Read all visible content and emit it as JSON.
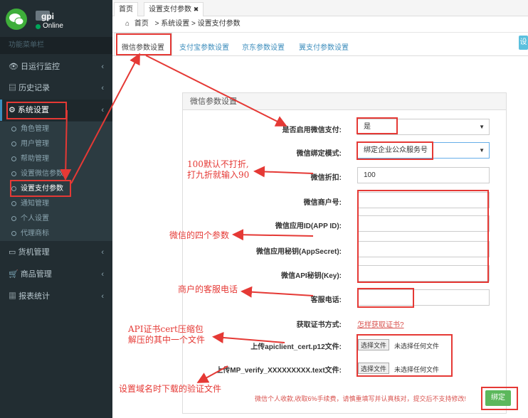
{
  "user": {
    "name": "gpi",
    "status": "Online"
  },
  "sidebar": {
    "header": "功能菜单栏",
    "items": [
      {
        "label": "日运行监控",
        "icon": "eye-icon"
      },
      {
        "label": "历史记录",
        "icon": "book-icon"
      },
      {
        "label": "系统设置",
        "icon": "gear-icon"
      },
      {
        "label": "货机管理",
        "icon": "laptop-icon"
      },
      {
        "label": "商品管理",
        "icon": "cart-icon"
      },
      {
        "label": "报表统计",
        "icon": "table-icon"
      }
    ],
    "subitems": [
      "角色管理",
      "用户管理",
      "帮助管理",
      "设置微信参数",
      "设置支付参数",
      "通知管理",
      "个人设置",
      "代理商标"
    ]
  },
  "top_tabs": {
    "home": "首页",
    "current": "设置支付参数",
    "close": "✖"
  },
  "breadcrumb": {
    "home": "首页",
    "path": "> 系统设置 > 设置支付参数"
  },
  "page_tabs": [
    "微信参数设置",
    "支付宝参数设置",
    "京东参数设置",
    "翼支付参数设置"
  ],
  "right_button": "设",
  "panel": {
    "title": "微信参数设置"
  },
  "form": {
    "enable_label": "是否启用微信支付:",
    "enable_value": "是",
    "mode_label": "微信绑定模式:",
    "mode_value": "绑定企业公众服务号",
    "discount_label": "微信折扣:",
    "discount_value": "100",
    "merchant_label": "微信商户号:",
    "appid_label": "微信应用ID(APP ID):",
    "secret_label": "微信应用秘钥(AppSecret):",
    "apikey_label": "微信API秘钥(Key):",
    "service_label": "客服电话:",
    "cert_label": "获取证书方式:",
    "cert_link": "怎样获取证书?",
    "p12_label": "上传apiclient_cert.p12文件:",
    "verify_label": "上传MP_verify_XXXXXXXXX.text文件:",
    "file_button": "选择文件",
    "no_file": "未选择任何文件",
    "warning": "微信个人收款,收取6%手续费，请慎重填写并认真核对，提交后不支持修改!",
    "submit": "绑定"
  },
  "annotations": {
    "discount": [
      "100默认不打折,",
      "打九折就输入90"
    ],
    "params": "微信的四个参数",
    "service": "商户的客服电话",
    "cert": [
      "API证书cert压缩包",
      "解压的其中一个文件"
    ],
    "domain": "设置域名时下载的验证文件"
  },
  "colors": {
    "sidebar": "#222d32",
    "accent": "#3c8dbc",
    "annotation": "#e53935",
    "submit": "#5cb85c"
  }
}
